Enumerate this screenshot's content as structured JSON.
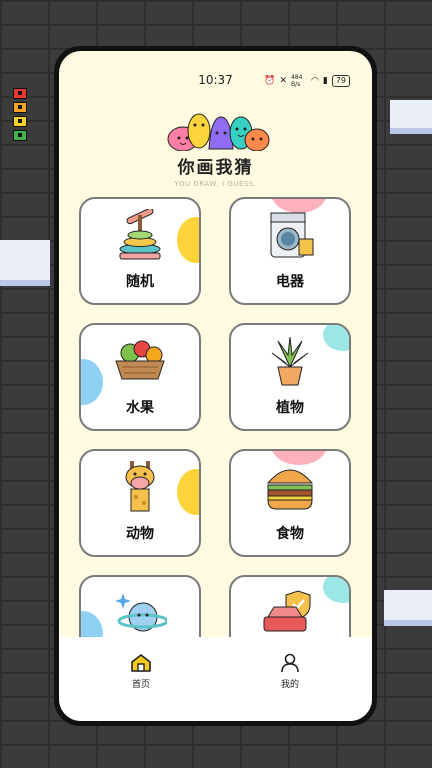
{
  "status_bar": {
    "time": "10:37",
    "network_speed": "484 B/s",
    "battery": "79"
  },
  "app": {
    "title": "你画我猜",
    "subtitle": "YOU DRAW, I GUESS."
  },
  "categories": [
    {
      "label": "随机",
      "icon": "ring-stacker-toy-icon"
    },
    {
      "label": "电器",
      "icon": "washing-machine-icon"
    },
    {
      "label": "水果",
      "icon": "fruit-basket-icon"
    },
    {
      "label": "植物",
      "icon": "potted-plant-icon"
    },
    {
      "label": "动物",
      "icon": "giraffe-icon"
    },
    {
      "label": "食物",
      "icon": "burger-icon"
    },
    {
      "label": "",
      "icon": "planet-icon"
    },
    {
      "label": "",
      "icon": "car-insurance-icon"
    }
  ],
  "tabbar": {
    "home_label": "首页",
    "mine_label": "我的"
  },
  "colors": {
    "background": "#fffbe1",
    "accent": "#f5c81e",
    "card_border": "#7a7a7a"
  }
}
